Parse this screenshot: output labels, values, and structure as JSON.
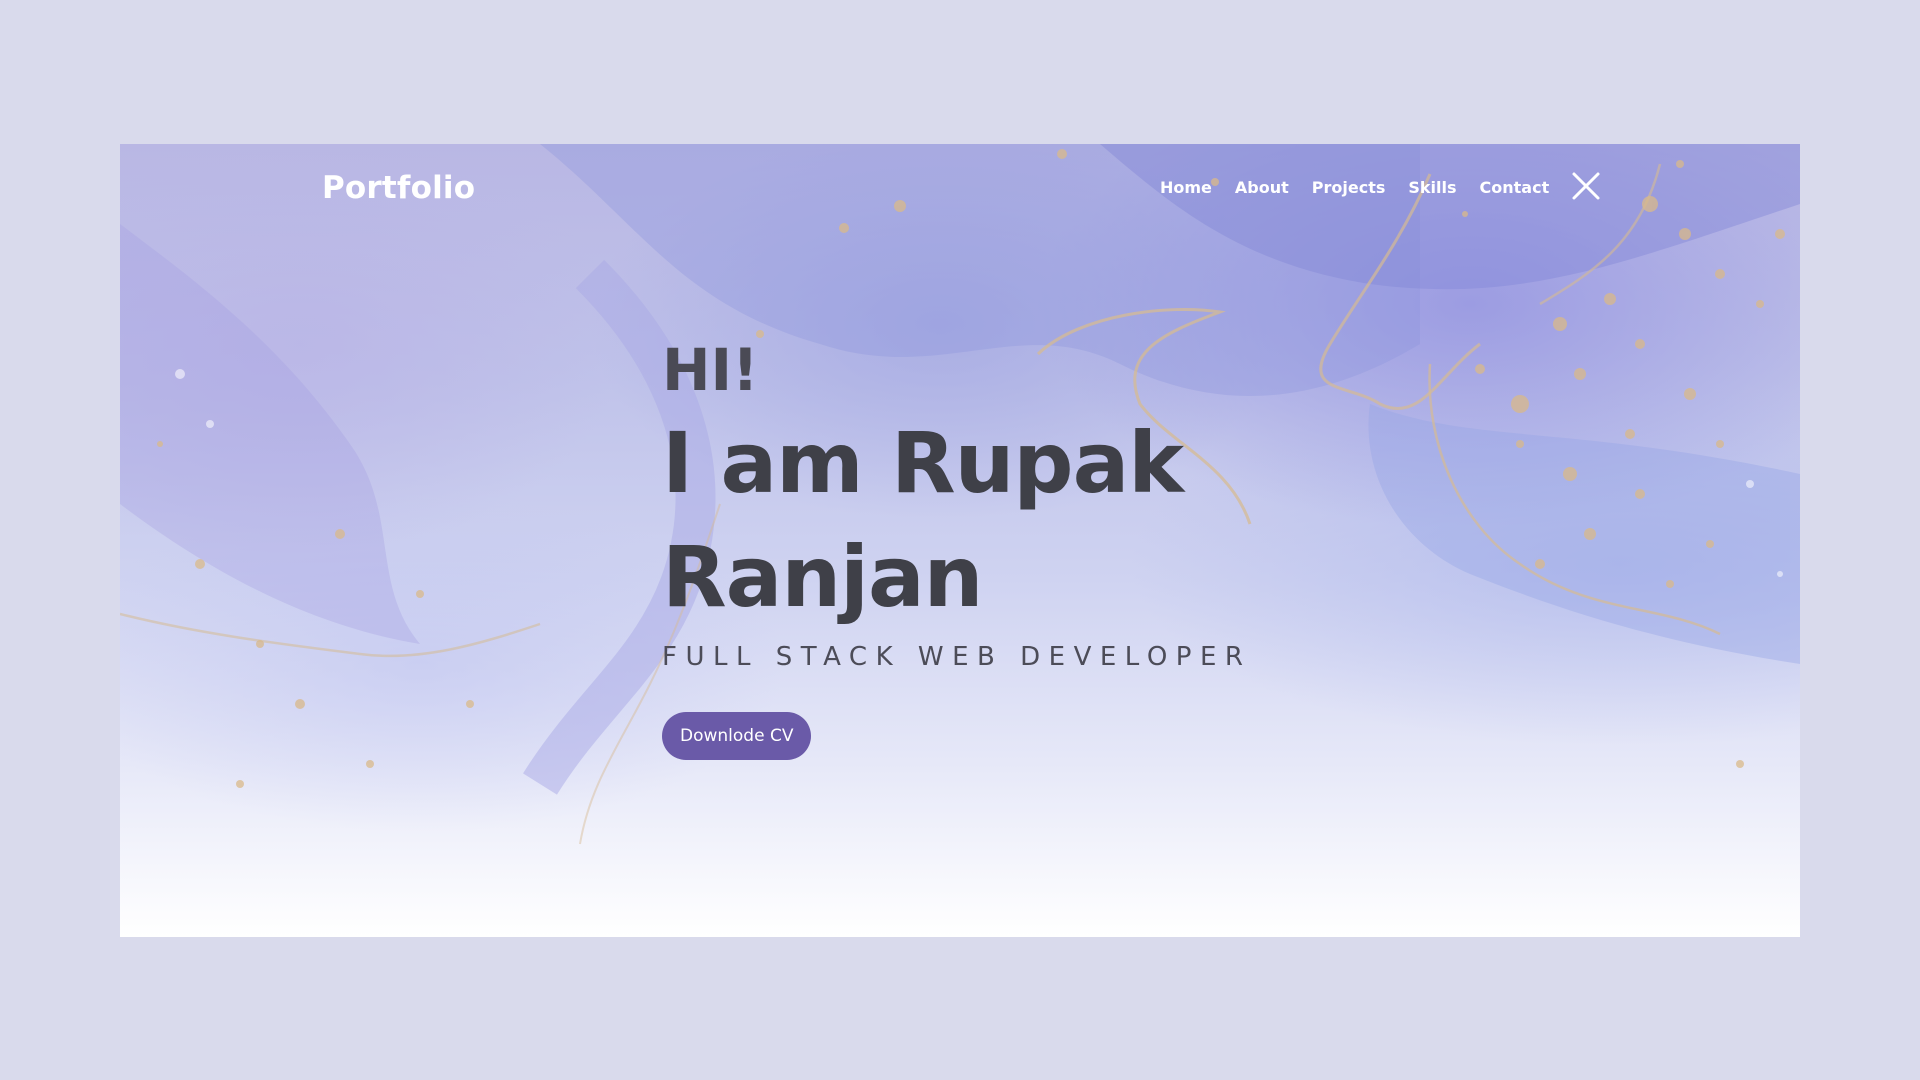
{
  "header": {
    "logo": "Portfolio",
    "nav": [
      "Home",
      "About",
      "Projects",
      "Skills",
      "Contact"
    ],
    "close_icon": "close-icon"
  },
  "hero": {
    "greeting": "HI!",
    "name": "I am Rupak Ranjan",
    "role": "FULL STACK WEB DEVELOPER",
    "cta_label": "Downlode CV"
  },
  "colors": {
    "page_background": "#d9daec",
    "heading_text": "#3f4048",
    "button_background": "#6a5aa8",
    "nav_text": "#ffffff",
    "gold_accent": "#d9b98a"
  }
}
